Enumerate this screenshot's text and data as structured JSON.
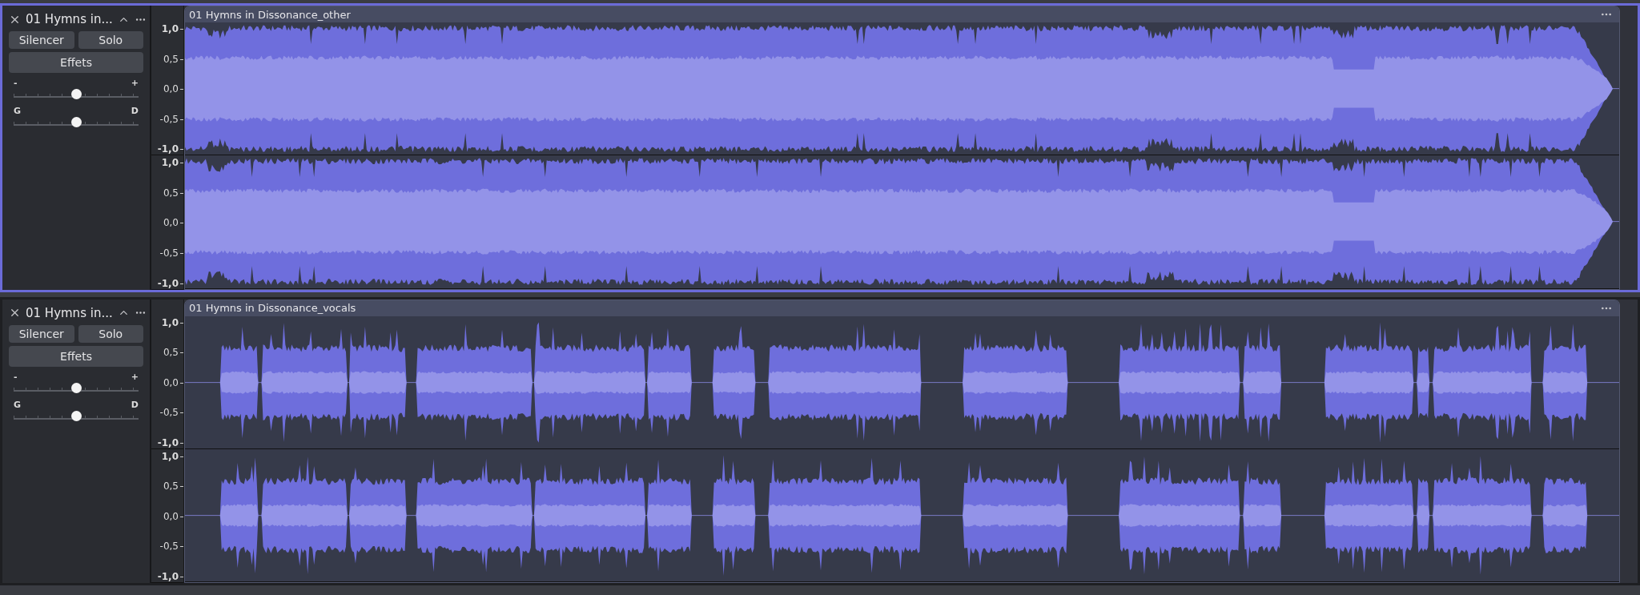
{
  "tracks": [
    {
      "name": "01 Hymns in...",
      "selected": true,
      "buttons": [
        "Silencer",
        "Solo",
        "Effets"
      ],
      "gain": {
        "min_label": "-",
        "max_label": "+",
        "level": 0.5
      },
      "pan": {
        "left_label": "G",
        "right_label": "D",
        "level": 0.5
      },
      "clip": {
        "title": "01 Hymns in Dissonance_other",
        "waveform": {
          "kind": "full"
        }
      },
      "channels": [
        {
          "ticks": [
            "1,0",
            "0,5",
            "0,0",
            "-0,5",
            "-1,0"
          ]
        },
        {
          "ticks": [
            "1,0",
            "0,5",
            "0,0",
            "-0,5",
            "-1,0"
          ]
        }
      ]
    },
    {
      "name": "01 Hymns in...",
      "selected": false,
      "buttons": [
        "Silencer",
        "Solo",
        "Effets"
      ],
      "gain": {
        "min_label": "-",
        "max_label": "+",
        "level": 0.5
      },
      "pan": {
        "left_label": "G",
        "right_label": "D",
        "level": 0.5
      },
      "clip": {
        "title": "01 Hymns in Dissonance_vocals",
        "waveform": {
          "kind": "gapped"
        }
      },
      "channels": [
        {
          "ticks": [
            "1,0",
            "0,5",
            "0,0",
            "-0,5",
            "-1,0"
          ]
        },
        {
          "ticks": [
            "1,0",
            "0,5",
            "0,0",
            "-0,5",
            "-1,0"
          ]
        }
      ]
    }
  ]
}
